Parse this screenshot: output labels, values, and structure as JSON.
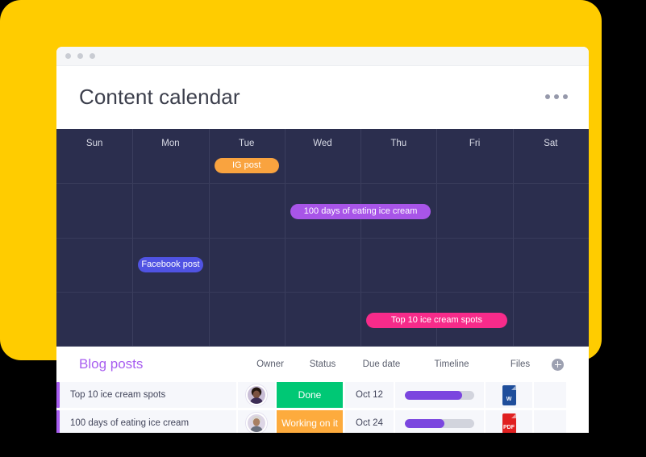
{
  "theme": {
    "backdrop_yellow": "#FFCC00",
    "calendar_bg": "#2b2e4e",
    "accent_purple": "#a85ef0",
    "timeline_purple": "#7b46df"
  },
  "window": {
    "traffic_dots": [
      "dot-1",
      "dot-2",
      "dot-3"
    ],
    "title": "Content calendar",
    "more_menu": "more-options"
  },
  "calendar": {
    "day_headers": [
      "Sun",
      "Mon",
      "Tue",
      "Wed",
      "Thu",
      "Fri",
      "Sat"
    ],
    "events": [
      {
        "label": "IG post",
        "color": "#f9a33f",
        "day": 2,
        "week": 0,
        "span": 1
      },
      {
        "label": "100 days of eating ice cream",
        "color": "#a855e8",
        "day": 3,
        "week": 1,
        "span": 2
      },
      {
        "label": "Facebook post",
        "color": "#5053e3",
        "day": 1,
        "week": 2,
        "span": 1
      },
      {
        "label": "Top 10 ice cream spots",
        "color": "#f72b8a",
        "day": 4,
        "week": 3,
        "span": 2
      }
    ]
  },
  "board": {
    "group_title": "Blog posts",
    "columns": [
      "Owner",
      "Status",
      "Due date",
      "Timeline",
      "Files"
    ],
    "add_column_label": "+",
    "rows": [
      {
        "name": "Top 10 ice cream spots",
        "owner": "avatar-person-1",
        "status": "Done",
        "status_color": "#00c875",
        "due_date": "Oct 12",
        "timeline_percent": 82,
        "file_type": "W",
        "file_color": "#1f4e9b"
      },
      {
        "name": "100 days of eating ice cream",
        "owner": "avatar-person-2",
        "status": "Working on it",
        "status_color": "#fdab3d",
        "due_date": "Oct 24",
        "timeline_percent": 57,
        "file_type": "PDF",
        "file_color": "#e02020"
      }
    ]
  }
}
